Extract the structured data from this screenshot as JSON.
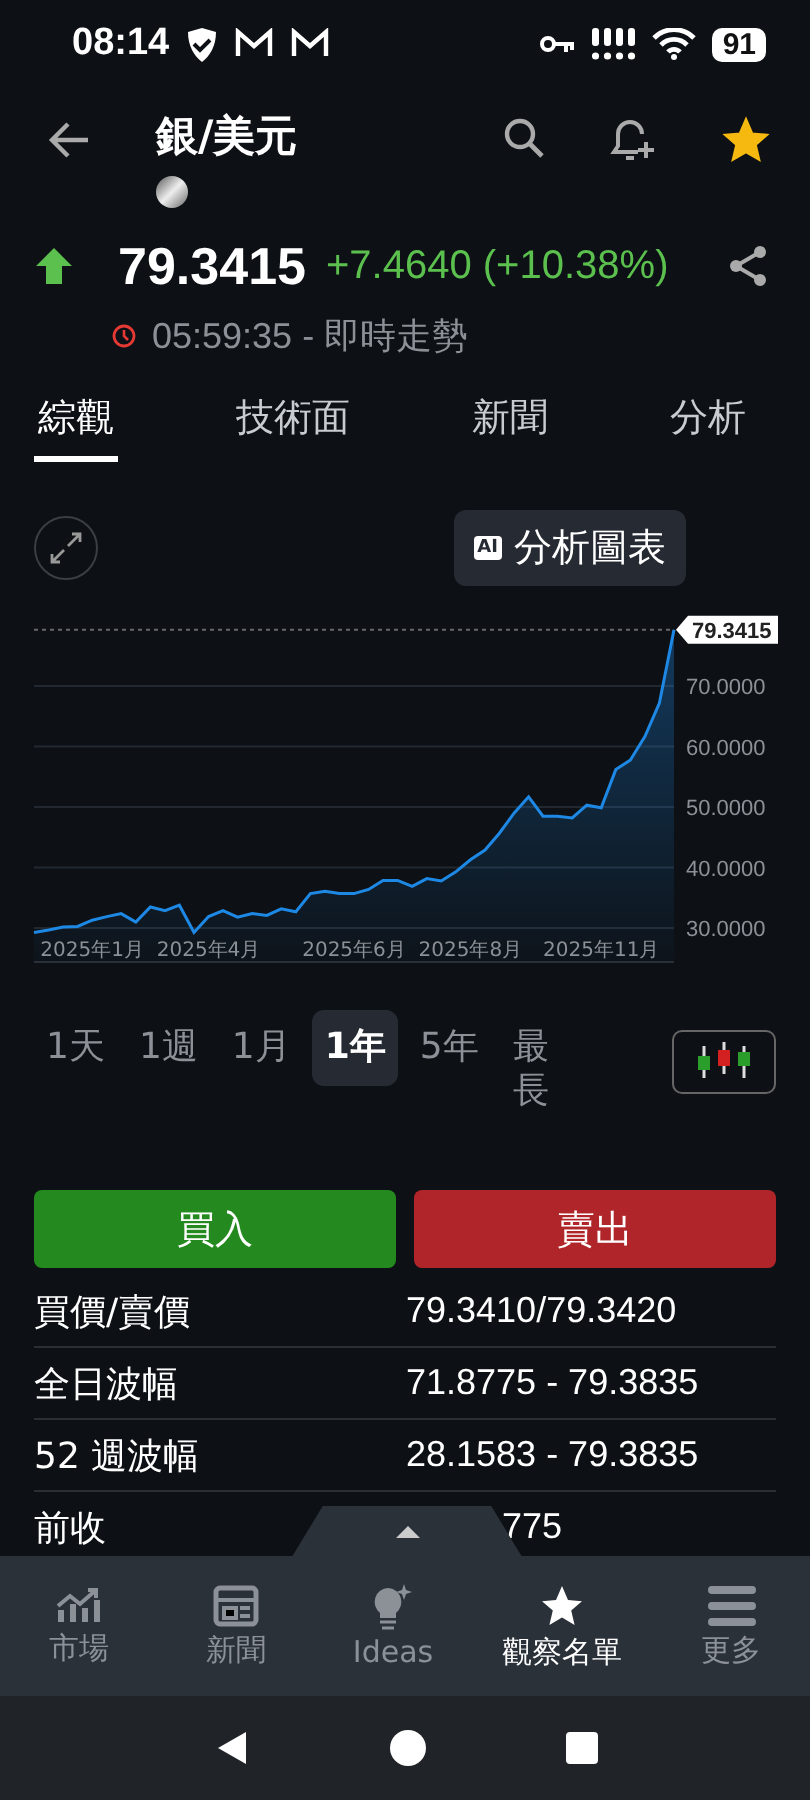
{
  "status_bar": {
    "time": "08:14",
    "battery": "91"
  },
  "header": {
    "title": "銀/美元",
    "favorite": true
  },
  "quote": {
    "price": "79.3415",
    "change": "+7.4640 (+10.38%)",
    "up": true,
    "time": "05:59:35 - 即時走勢"
  },
  "tabs": [
    {
      "label": "綜觀",
      "selected": true
    },
    {
      "label": "技術面",
      "selected": false
    },
    {
      "label": "新聞",
      "selected": false
    },
    {
      "label": "分析",
      "selected": false
    }
  ],
  "ai_button": {
    "badge": "AI",
    "label": "分析圖表"
  },
  "chart": {
    "last_label": "79.3415",
    "chart_data": {
      "type": "area",
      "categories": [
        null,
        null,
        null,
        null,
        "2025年1月",
        null,
        null,
        null,
        null,
        null,
        null,
        null,
        "2025年4月",
        null,
        null,
        null,
        null,
        null,
        null,
        null,
        null,
        null,
        "2025年6月",
        null,
        null,
        null,
        null,
        null,
        null,
        null,
        "2025年8月",
        null,
        null,
        null,
        null,
        null,
        null,
        null,
        null,
        "2025年11月",
        null,
        null,
        null,
        null,
        null
      ],
      "series": [
        {
          "color": "#1e88e5",
          "values": [
            29.3,
            29.7,
            30.2,
            30.3,
            31.3,
            31.9,
            32.4,
            31.0,
            33.5,
            32.9,
            33.8,
            29.3,
            31.9,
            32.9,
            31.8,
            32.4,
            32.1,
            33.2,
            32.7,
            35.7,
            36.1,
            35.7,
            35.7,
            36.4,
            37.9,
            37.9,
            36.9,
            38.2,
            37.8,
            39.3,
            41.3,
            42.9,
            45.7,
            49.0,
            51.7,
            48.5,
            48.5,
            48.2,
            50.3,
            49.9,
            56.2,
            57.8,
            61.7,
            67.2,
            79.3
          ]
        }
      ],
      "grid": true,
      "ylim": [
        24.4,
        80
      ],
      "yticks": [
        {
          "value": 30,
          "label": "30.0000"
        },
        {
          "value": 40,
          "label": "40.0000"
        },
        {
          "value": 50,
          "label": "50.0000"
        },
        {
          "value": 60,
          "label": "60.0000"
        },
        {
          "value": 70,
          "label": "70.0000"
        }
      ]
    }
  },
  "ranges": [
    {
      "label": "1天",
      "selected": false
    },
    {
      "label": "1週",
      "selected": false
    },
    {
      "label": "1月",
      "selected": false
    },
    {
      "label": "1年",
      "selected": true
    },
    {
      "label": "5年",
      "selected": false
    },
    {
      "label": "最長",
      "selected": false
    }
  ],
  "trade_buttons": [
    {
      "kind": "buy",
      "label": "買入"
    },
    {
      "kind": "sell",
      "label": "賣出"
    }
  ],
  "stats": [
    {
      "label": "買價/賣價",
      "value": "79.3410/79.3420",
      "kind": "full"
    },
    {
      "label": "全日波幅",
      "value": "71.8775 - 79.3835",
      "kind": "full"
    },
    {
      "label": "52 週波幅",
      "value": "28.1583 - 79.3835",
      "kind": "full"
    },
    {
      "label": "前收",
      "value": "775",
      "kind": "covered"
    }
  ],
  "bottom_nav": [
    {
      "kind": "markets",
      "label": "市場",
      "selected": false
    },
    {
      "kind": "news",
      "label": "新聞",
      "selected": false
    },
    {
      "kind": "ideas",
      "label": "Ideas",
      "selected": false
    },
    {
      "kind": "watchlist",
      "label": "觀察名單",
      "selected": true
    },
    {
      "kind": "more",
      "label": "更多",
      "selected": false
    }
  ]
}
